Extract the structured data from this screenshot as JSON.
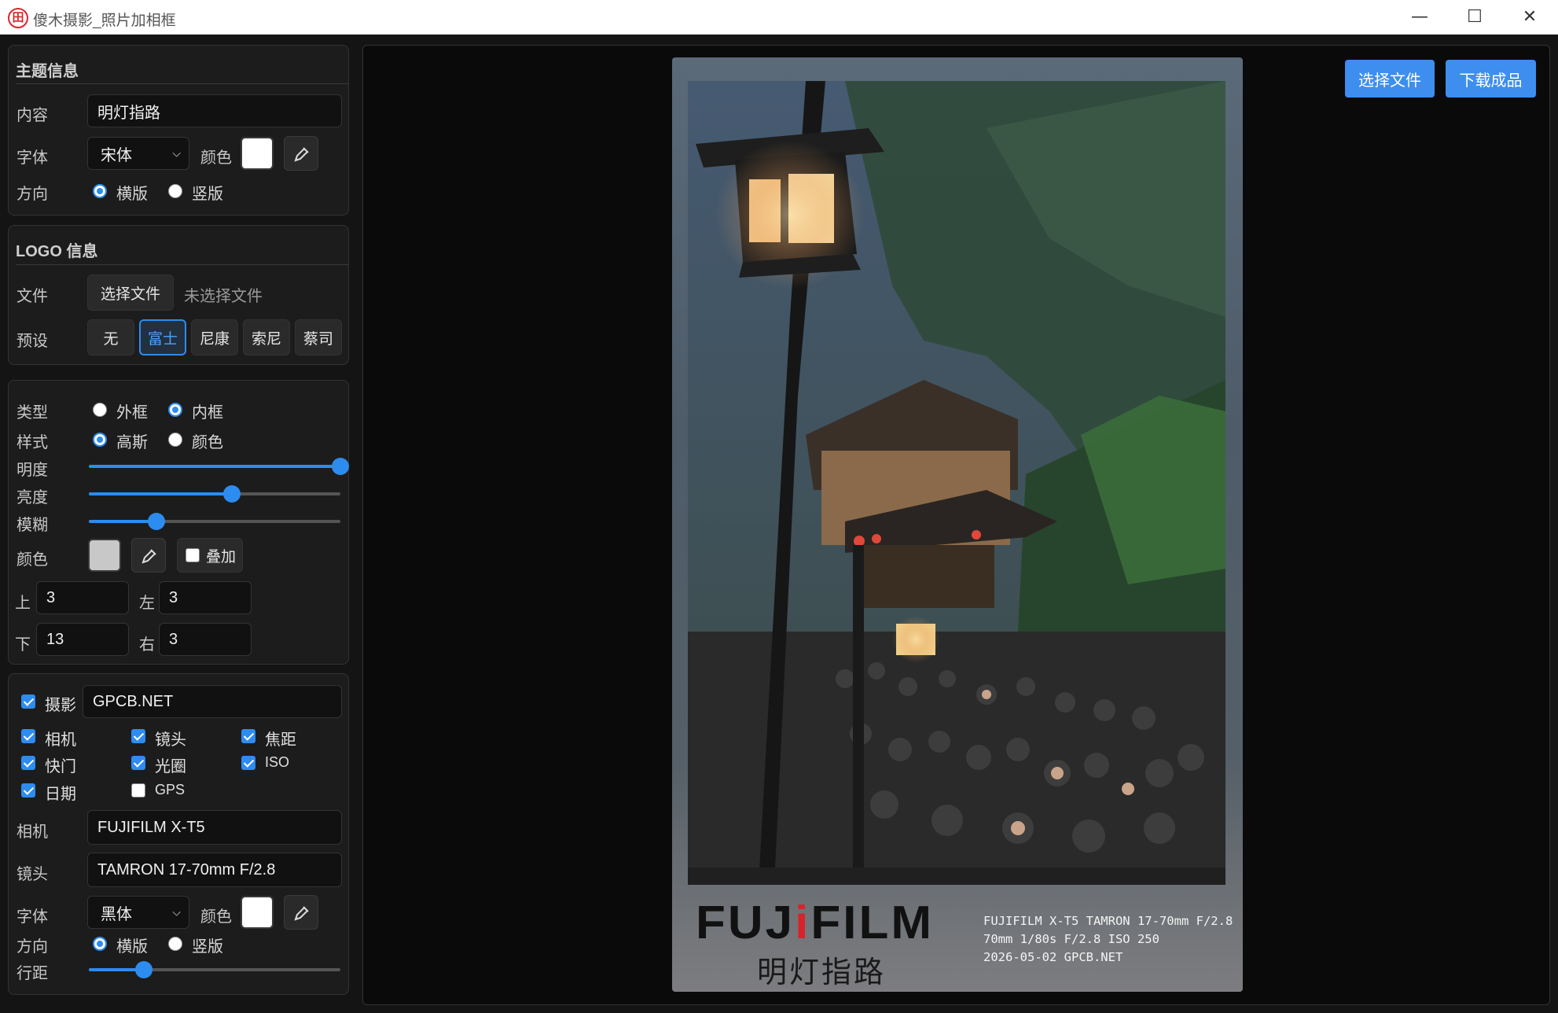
{
  "window": {
    "title": "傻木摄影_照片加相框",
    "logo_glyph": "田",
    "min": "—",
    "max": "☐",
    "close": "✕"
  },
  "theme": {
    "section_title": "主题信息",
    "content_label": "内容",
    "content_value": "明灯指路",
    "font_label": "字体",
    "font_value": "宋体",
    "color_label": "颜色",
    "color": "#ffffff",
    "direction_label": "方向",
    "horizontal": "横版",
    "vertical": "竖版",
    "direction_selected": "横版"
  },
  "logo": {
    "section_title": "LOGO 信息",
    "file_label": "文件",
    "choose_file": "选择文件",
    "no_file": "未选择文件",
    "preset_label": "预设",
    "presets": [
      "无",
      "富士",
      "尼康",
      "索尼",
      "蔡司"
    ],
    "preset_selected": "富士"
  },
  "frame": {
    "type_label": "类型",
    "type_outer": "外框",
    "type_inner": "内框",
    "type_selected": "内框",
    "style_label": "样式",
    "style_gauss": "高斯",
    "style_color": "颜色",
    "style_selected": "高斯",
    "lightness_label": "明度",
    "lightness": 1.0,
    "brightness_label": "亮度",
    "brightness": 0.57,
    "blur_label": "模糊",
    "blur": 0.27,
    "color_label": "颜色",
    "color": "#c8c8c8",
    "overlay_label": "叠加",
    "overlay_checked": false,
    "top_label": "上",
    "top": "3",
    "left_label": "左",
    "left": "3",
    "bottom_label": "下",
    "bottom": "13",
    "right_label": "右",
    "right": "3"
  },
  "exif": {
    "photographer_label": "摄影",
    "photographer_checked": true,
    "photographer": "GPCB.NET",
    "toggles": [
      {
        "label": "相机",
        "checked": true
      },
      {
        "label": "镜头",
        "checked": true
      },
      {
        "label": "焦距",
        "checked": true
      },
      {
        "label": "快门",
        "checked": true
      },
      {
        "label": "光圈",
        "checked": true
      },
      {
        "label": "ISO",
        "checked": true
      },
      {
        "label": "日期",
        "checked": true
      },
      {
        "label": "GPS",
        "checked": false
      }
    ],
    "camera_label": "相机",
    "camera": "FUJIFILM X-T5",
    "lens_label": "镜头",
    "lens": "TAMRON 17-70mm F/2.8",
    "font_label": "字体",
    "font_value": "黑体",
    "color_label": "颜色",
    "color": "#ffffff",
    "direction_label": "方向",
    "horizontal": "横版",
    "vertical": "竖版",
    "direction_selected": "横版",
    "line_spacing_label": "行距",
    "line_spacing": 0.22
  },
  "toolbar": {
    "choose_file": "选择文件",
    "download": "下载成品"
  },
  "preview": {
    "logo_text_a": "FUJ",
    "logo_text_i": "i",
    "logo_text_b": "FILM",
    "title": "明灯指路",
    "exif_lines": [
      "FUJIFILM X-T5 TAMRON 17-70mm F/2.8",
      "70mm 1/80s F/2.8 ISO 250",
      "2026-05-02 GPCB.NET"
    ]
  }
}
